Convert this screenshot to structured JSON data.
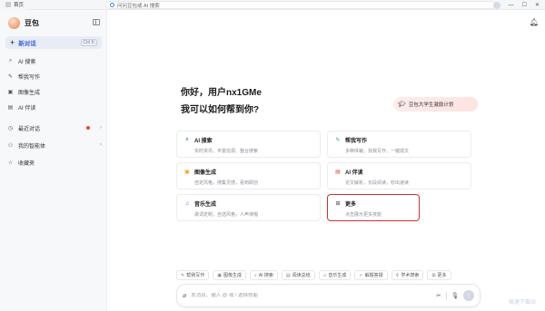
{
  "topbar": {
    "tab_label": "首页",
    "address": "问问豆包或 AI 搜索"
  },
  "sidebar": {
    "brand": "豆包",
    "new_chat": "新对话",
    "new_chat_kbd": "Ctrl K",
    "items": [
      {
        "icon": "search-icon",
        "label": "AI 搜索"
      },
      {
        "icon": "pen-icon",
        "label": "帮我写作"
      },
      {
        "icon": "image-icon",
        "label": "图像生成"
      },
      {
        "icon": "read-icon",
        "label": "AI 伴读"
      },
      {
        "icon": "clock-icon",
        "label": "最近对话"
      },
      {
        "icon": "agent-icon",
        "label": "我的智能体"
      },
      {
        "icon": "star-icon",
        "label": "收藏夹"
      }
    ]
  },
  "main": {
    "greeting": "你好，用户nx1GMe",
    "prompt": "我可以如何帮到你?",
    "promo": "豆包大学生激励计划",
    "cards": [
      {
        "title": "AI 搜索",
        "desc": "实时资讯、丰富信源、整合搜索",
        "icon": "search-icon"
      },
      {
        "title": "帮我写作",
        "desc": "多种体裁，找我写作，一键成文",
        "icon": "pen-icon"
      },
      {
        "title": "图像生成",
        "desc": "自定风格，搜集灵感，看到即创",
        "icon": "image-icon"
      },
      {
        "title": "AI 伴读",
        "desc": "论文解析，长段阅读，秒出速读",
        "icon": "read-icon"
      },
      {
        "title": "音乐生成",
        "desc": "歌词定制，自选风格，人声演唱",
        "icon": "music-icon"
      },
      {
        "title": "更多",
        "desc": "点击展示更多技能",
        "icon": "grid-icon"
      }
    ],
    "chips": [
      {
        "icon": "pen-icon",
        "label": "帮我写作"
      },
      {
        "icon": "image-icon",
        "label": "图像生成"
      },
      {
        "icon": "search-icon",
        "label": "AI 搜索"
      },
      {
        "icon": "read-icon",
        "label": "阅读总结"
      },
      {
        "icon": "music-icon",
        "label": "音乐生成"
      },
      {
        "icon": "solve-icon",
        "label": "解题答疑"
      },
      {
        "icon": "academic-icon",
        "label": "学术搜索"
      },
      {
        "icon": "more-icon",
        "label": "更多"
      }
    ],
    "input_placeholder": "发消息、输入 @ 或 / 选择技能",
    "watermark": "极速下载站"
  },
  "colors": {
    "accent": "#3d63d9",
    "highlight_border": "#d22f2f"
  }
}
